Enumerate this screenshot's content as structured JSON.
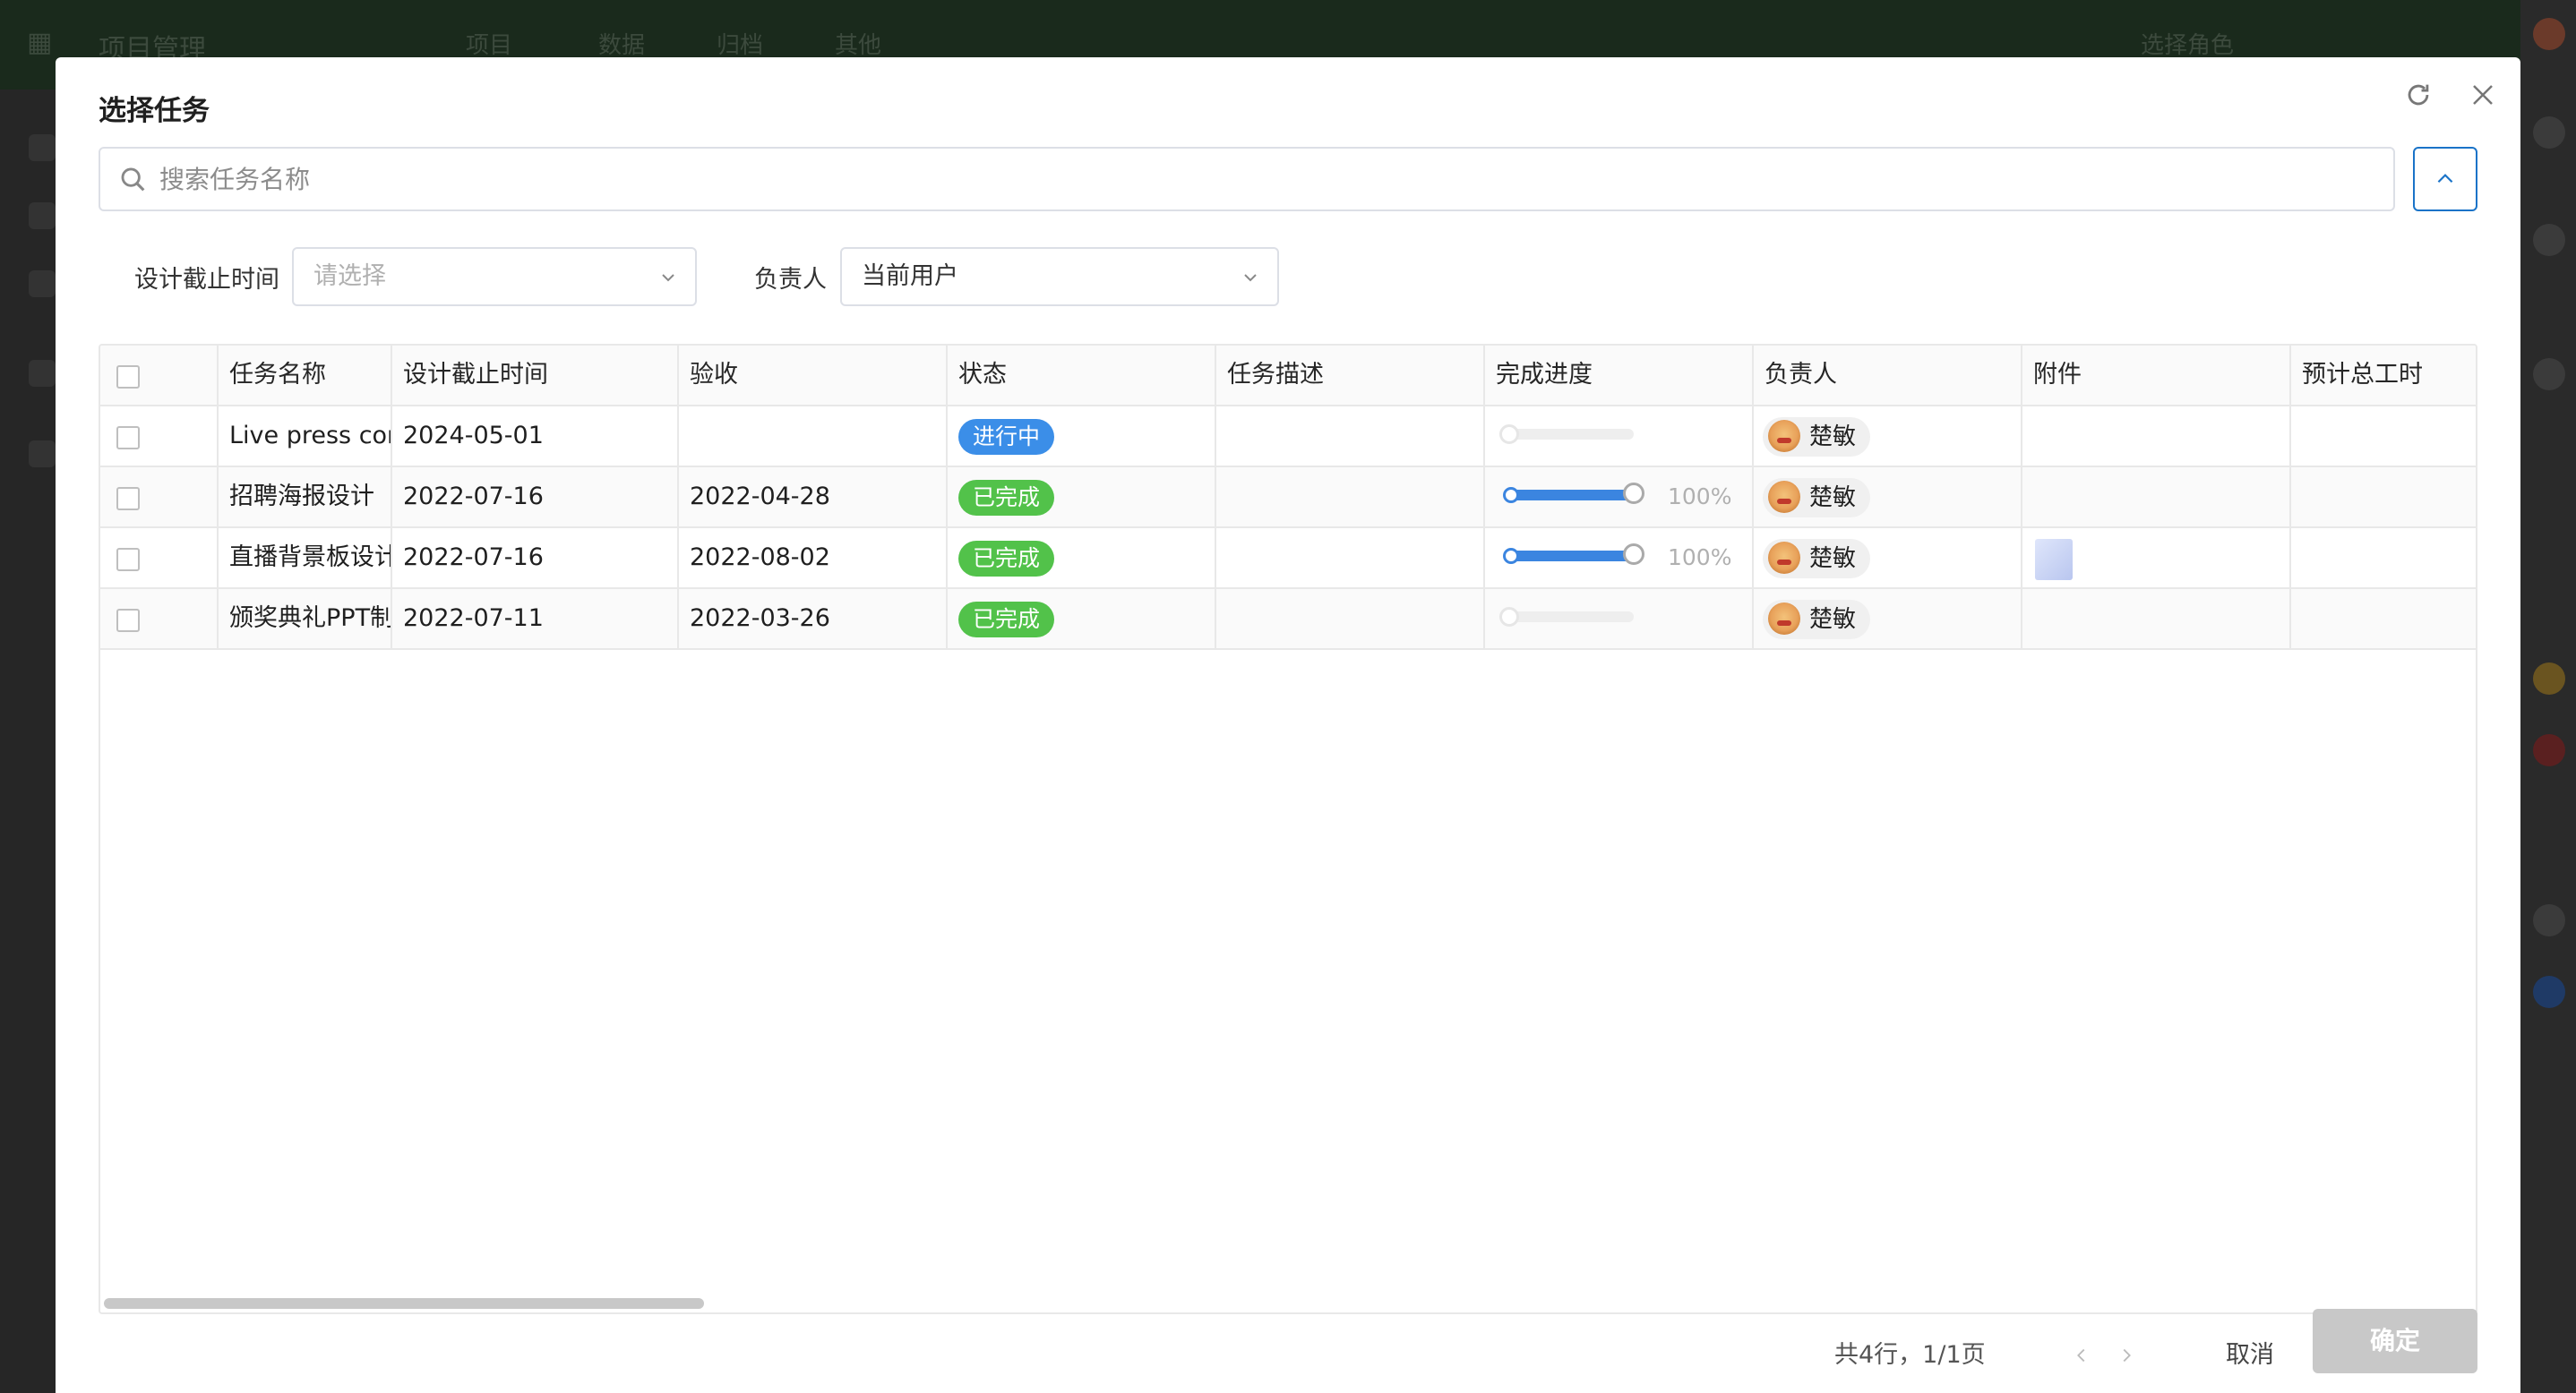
{
  "background": {
    "nav": [
      "项目管理",
      "项目",
      "数据",
      "归档",
      "其他",
      "选择角色"
    ]
  },
  "modal": {
    "title": "选择任务",
    "search_placeholder": "搜索任务名称",
    "filters": {
      "due_label": "设计截止时间",
      "due_placeholder": "请选择",
      "owner_label": "负责人",
      "owner_value": "当前用户"
    },
    "table": {
      "columns": [
        "任务名称",
        "设计截止时间",
        "验收",
        "状态",
        "任务描述",
        "完成进度",
        "负责人",
        "附件",
        "预计总工时"
      ],
      "rows": [
        {
          "name": "Live press conf",
          "due": "2024-05-01",
          "accept": "",
          "status": "进行中",
          "status_color": "#3b8ee8",
          "desc": "",
          "progress": 0,
          "progress_label": "",
          "owner": "楚敏",
          "has_attachment": false,
          "hours": ""
        },
        {
          "name": "招聘海报设计",
          "due": "2022-07-16",
          "accept": "2022-04-28",
          "status": "已完成",
          "status_color": "#52c24a",
          "desc": "",
          "progress": 100,
          "progress_label": "100%",
          "owner": "楚敏",
          "has_attachment": false,
          "hours": ""
        },
        {
          "name": "直播背景板设计",
          "due": "2022-07-16",
          "accept": "2022-08-02",
          "status": "已完成",
          "status_color": "#52c24a",
          "desc": "",
          "progress": 100,
          "progress_label": "100%",
          "owner": "楚敏",
          "has_attachment": true,
          "hours": ""
        },
        {
          "name": "颁奖典礼PPT制",
          "due": "2022-07-11",
          "accept": "2022-03-26",
          "status": "已完成",
          "status_color": "#52c24a",
          "desc": "",
          "progress": 0,
          "progress_label": "",
          "owner": "楚敏",
          "has_attachment": false,
          "hours": ""
        }
      ]
    },
    "footer": {
      "summary": "共4行，1/1页",
      "cancel_label": "取消",
      "ok_label": "确定"
    }
  },
  "colors": {
    "accent": "#1a73c8",
    "progress": "#3b85e0",
    "disabled_button": "#c8c8c8"
  }
}
